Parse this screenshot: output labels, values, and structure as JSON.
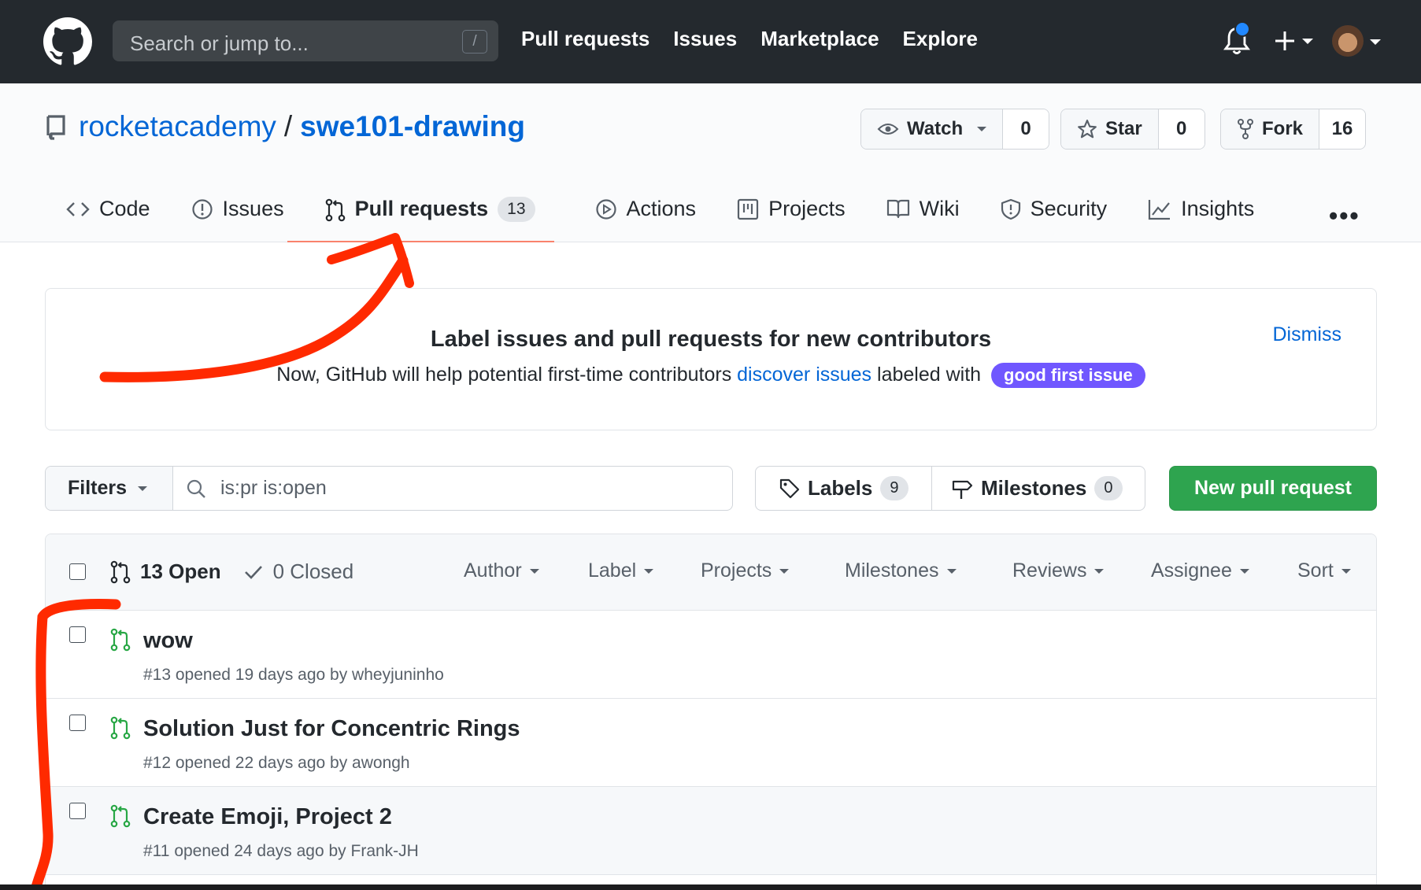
{
  "header": {
    "search_placeholder": "Search or jump to...",
    "slash_hint": "/",
    "nav": [
      "Pull requests",
      "Issues",
      "Marketplace",
      "Explore"
    ]
  },
  "repo": {
    "owner": "rocketacademy",
    "separator": "/",
    "name": "swe101-drawing",
    "watch_label": "Watch",
    "watch_count": "0",
    "star_label": "Star",
    "star_count": "0",
    "fork_label": "Fork",
    "fork_count": "16"
  },
  "tabs": [
    {
      "label": "Code",
      "icon": "code-icon"
    },
    {
      "label": "Issues",
      "icon": "issue-icon"
    },
    {
      "label": "Pull requests",
      "icon": "pull-request-icon",
      "counter": "13",
      "selected": true
    },
    {
      "label": "Actions",
      "icon": "play-icon"
    },
    {
      "label": "Projects",
      "icon": "project-icon"
    },
    {
      "label": "Wiki",
      "icon": "book-icon"
    },
    {
      "label": "Security",
      "icon": "shield-icon"
    },
    {
      "label": "Insights",
      "icon": "graph-icon"
    }
  ],
  "more_label": "•••",
  "banner": {
    "title": "Label issues and pull requests for new contributors",
    "desc_prefix": "Now, GitHub will help potential first-time contributors ",
    "desc_link": "discover issues",
    "desc_suffix": " labeled with",
    "label": "good first issue",
    "dismiss": "Dismiss"
  },
  "subnav": {
    "filters_label": "Filters",
    "query": "is:pr is:open",
    "labels_label": "Labels",
    "labels_count": "9",
    "milestones_label": "Milestones",
    "milestones_count": "0",
    "new_pr_label": "New pull request"
  },
  "list": {
    "open_label": "13 Open",
    "closed_label": "0 Closed",
    "filters": [
      "Author",
      "Label",
      "Projects",
      "Milestones",
      "Reviews",
      "Assignee",
      "Sort"
    ],
    "items": [
      {
        "title": "wow",
        "meta": "#13 opened 19 days ago by wheyjuninho"
      },
      {
        "title": "Solution Just for Concentric Rings",
        "meta": "#12 opened 22 days ago by awongh"
      },
      {
        "title": "Create Emoji, Project 2",
        "meta": "#11 opened 24 days ago by Frank-JH"
      }
    ]
  },
  "colors": {
    "header_bg": "#24292e",
    "link": "#0366d6",
    "green": "#2ea44f",
    "good_first_issue": "#7057ff",
    "tab_underline": "#f9826c",
    "annotation": "#ff2a00"
  }
}
